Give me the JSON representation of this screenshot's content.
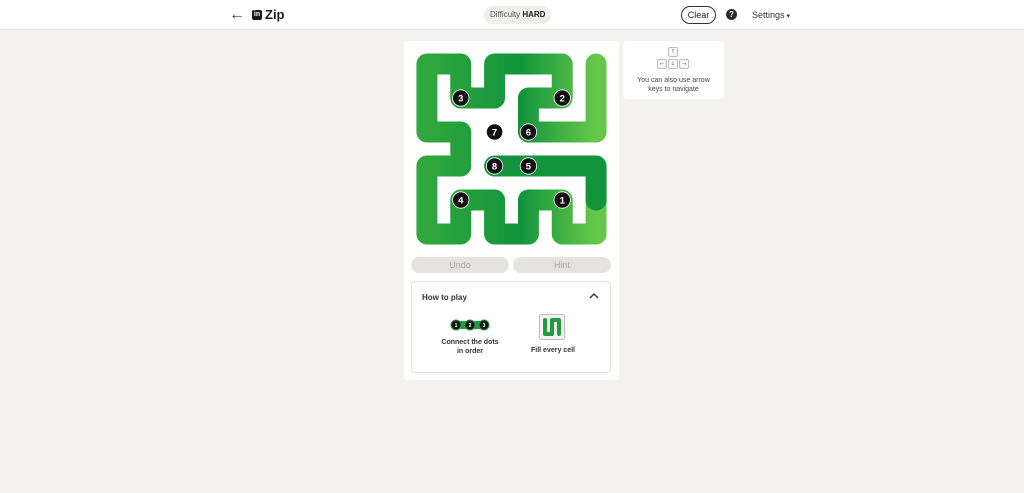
{
  "header": {
    "back_glyph": "←",
    "logo_text": "in",
    "title": "Zip",
    "difficulty_label": "Difficulty",
    "difficulty_value": "HARD",
    "clear_label": "Clear",
    "help_glyph": "?",
    "settings_label": "Settings",
    "settings_caret": "▾"
  },
  "board": {
    "grid_size": 6,
    "path_cells": [
      [
        4,
        5
      ],
      [
        5,
        5
      ],
      [
        5,
        4
      ],
      [
        4,
        4
      ],
      [
        4,
        3
      ],
      [
        5,
        3
      ],
      [
        5,
        2
      ],
      [
        4,
        2
      ],
      [
        4,
        1
      ],
      [
        5,
        1
      ],
      [
        5,
        0
      ],
      [
        4,
        0
      ],
      [
        4,
        0
      ],
      [
        3,
        0
      ],
      [
        3,
        1
      ],
      [
        2,
        1
      ],
      [
        2,
        0
      ],
      [
        1,
        0
      ],
      [
        0,
        0
      ],
      [
        0,
        1
      ],
      [
        1,
        1
      ],
      [
        1,
        2
      ],
      [
        0,
        2
      ],
      [
        0,
        3
      ],
      [
        0,
        4
      ],
      [
        1,
        4
      ],
      [
        1,
        3
      ],
      [
        2,
        3
      ],
      [
        2,
        4
      ],
      [
        2,
        5
      ],
      [
        1,
        5
      ],
      [
        0,
        5
      ]
    ],
    "path_order": [
      [
        4,
        5
      ],
      [
        5,
        5
      ],
      [
        5,
        4
      ],
      [
        4,
        4
      ],
      [
        4,
        3
      ],
      [
        5,
        3
      ],
      [
        5,
        2
      ],
      [
        4,
        2
      ],
      [
        4,
        1
      ],
      [
        5,
        1
      ],
      [
        5,
        0
      ],
      [
        4,
        0
      ],
      [
        3,
        0
      ],
      [
        3,
        1
      ],
      [
        2,
        1
      ],
      [
        2,
        0
      ],
      [
        1,
        0
      ],
      [
        0,
        0
      ],
      [
        0,
        1
      ],
      [
        1,
        1
      ],
      [
        1,
        2
      ],
      [
        0,
        2
      ],
      [
        0,
        3
      ],
      [
        0,
        4
      ],
      [
        1,
        4
      ],
      [
        1,
        3
      ],
      [
        2,
        3
      ],
      [
        2,
        4
      ],
      [
        2,
        5
      ],
      [
        1,
        5
      ],
      [
        0,
        5
      ]
    ],
    "inner_path": [
      [
        3,
        2
      ],
      [
        3,
        3
      ],
      [
        3,
        4
      ],
      [
        3,
        5
      ],
      [
        4,
        5
      ]
    ],
    "dots": [
      {
        "label": "1",
        "row": 4,
        "col": 4
      },
      {
        "label": "2",
        "row": 1,
        "col": 4
      },
      {
        "label": "3",
        "row": 1,
        "col": 1
      },
      {
        "label": "4",
        "row": 4,
        "col": 1
      },
      {
        "label": "5",
        "row": 3,
        "col": 3
      },
      {
        "label": "6",
        "row": 2,
        "col": 3
      },
      {
        "label": "7",
        "row": 2,
        "col": 2
      },
      {
        "label": "8",
        "row": 3,
        "col": 2
      }
    ],
    "colors": {
      "light": "#66c84a",
      "mid": "#2fa83d",
      "dark": "#12943d",
      "dot": "#111111"
    }
  },
  "controls": {
    "undo_label": "Undo",
    "hint_label": "Hint"
  },
  "howto": {
    "title": "How to play",
    "toggle_icon": "chevron-up-icon",
    "step1_dots": [
      "1",
      "2",
      "3"
    ],
    "step1_text": "Connect the dots in order",
    "step2_text": "Fill every cell"
  },
  "tip": {
    "keys": {
      "up": "↑",
      "left": "←",
      "down": "↓",
      "right": "→"
    },
    "text": "You can also use arrow keys to navigate"
  }
}
